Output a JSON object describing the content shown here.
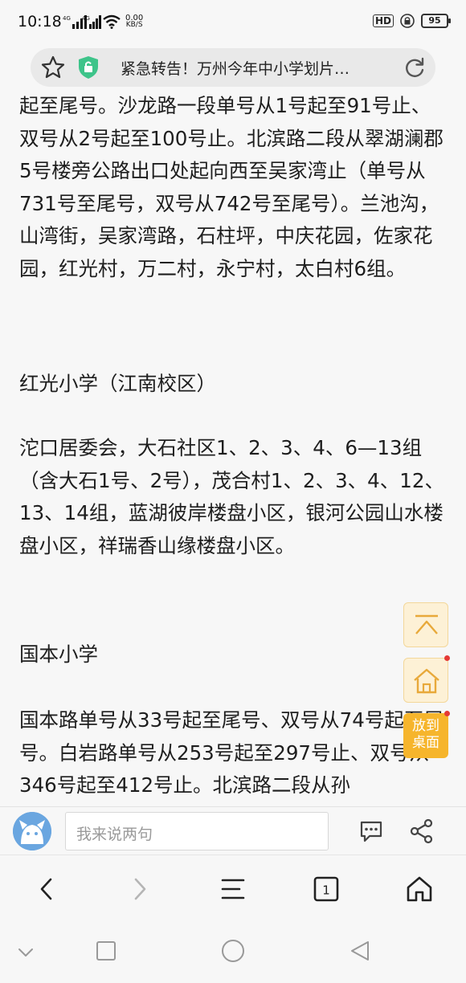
{
  "status_bar": {
    "time": "10:18",
    "signal_1": "4G",
    "signal_2": "4G",
    "net_speed_value": "0.00",
    "net_speed_unit": "KB/S",
    "hd_label": "HD",
    "battery": "95"
  },
  "url_bar": {
    "title": "紧急转告！万州今年中小学划片…",
    "shield_color": "#3ec48a"
  },
  "article": {
    "paragraphs": [
      "起至尾号。沙龙路一段单号从1号起至91号止、双号从2号起至100号止。北滨路二段从翠湖澜郡5号楼旁公路出口处起向西至吴家湾止（单号从731号至尾号，双号从742号至尾号）。兰池沟，山湾街，吴家湾路，石柱坪，中庆花园，佐家花园，红光村，万二村，永宁村，太白村6组。",
      "红光小学（江南校区）",
      "沱口居委会，大石社区1、2、3、4、6—13组（含大石1号、2号），茂合村1、2、3、4、12、13、14组，蓝湖彼岸楼盘小区，银河公园山水楼盘小区，祥瑞香山缘楼盘小区。",
      "国本小学",
      "国本路单号从33号起至尾号、双号从74号起至尾号。白岩路单号从253号起至297号止、双号从346号起至412号止。北滨路二段从孙"
    ]
  },
  "floating": {
    "back_to_top_icon": "arrow-up-icon",
    "home_icon": "home-icon",
    "desktop_label_line1": "放到",
    "desktop_label_line2": "桌面",
    "accent": "#f6b52c"
  },
  "comment_bar": {
    "placeholder": "我来说两句"
  },
  "toolbar": {
    "tab_count": "1"
  }
}
